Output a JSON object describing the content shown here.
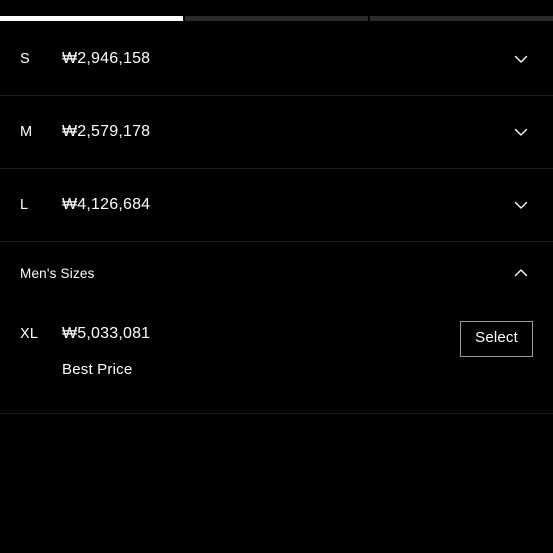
{
  "progress": {
    "segments": [
      {
        "name": "step-1",
        "active": true
      },
      {
        "name": "step-2",
        "active": false
      },
      {
        "name": "step-3",
        "active": false
      }
    ],
    "active_color": "#ffffff",
    "inactive_color": "#2b2b2b"
  },
  "colors": {
    "background": "#000000",
    "text": "#ffffff",
    "divider": "#1c1c1c",
    "button_border": "#9a9a9a"
  },
  "currency_symbol": "₩",
  "sizes": [
    {
      "label": "S",
      "price": "₩2,946,158",
      "chevron": "chevron-down-icon",
      "expanded": false
    },
    {
      "label": "M",
      "price": "₩2,579,178",
      "chevron": "chevron-down-icon",
      "expanded": false
    },
    {
      "label": "L",
      "price": "₩4,126,684",
      "chevron": "chevron-down-icon",
      "expanded": false
    }
  ],
  "section": {
    "title": "Men's Sizes",
    "chevron": "chevron-up-icon",
    "expanded": true,
    "items": [
      {
        "label": "XL",
        "price": "₩5,033,081",
        "badge": "Best Price",
        "action_label": "Select"
      }
    ]
  }
}
